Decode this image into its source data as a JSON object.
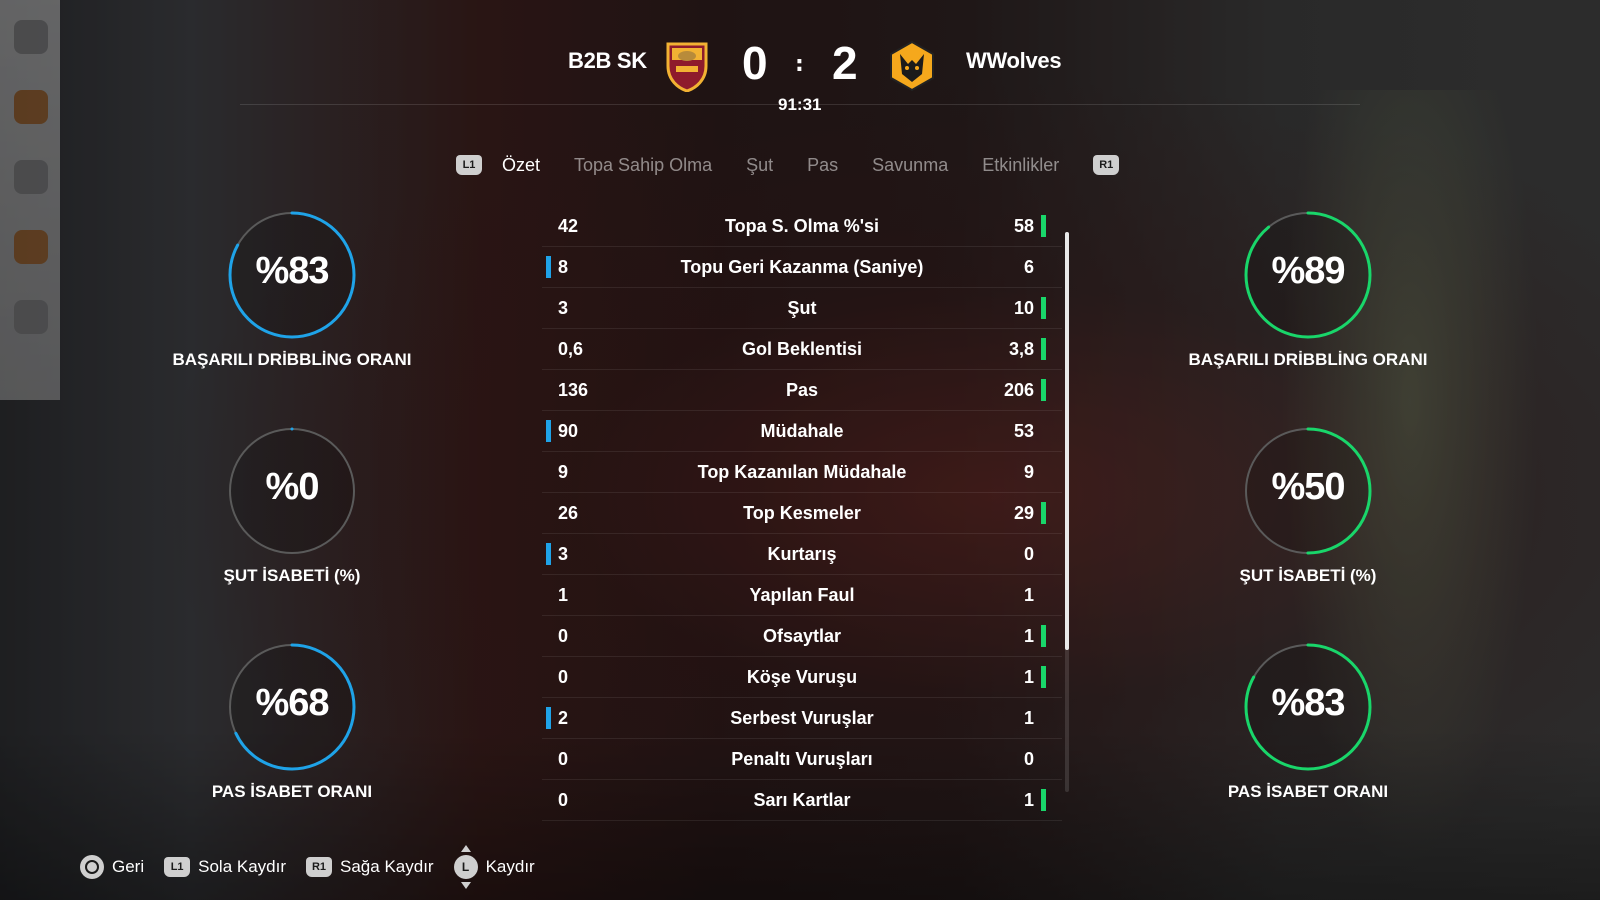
{
  "match": {
    "home_team": "B2B SK",
    "away_team": "WWolves",
    "home_score": "0",
    "away_score": "2",
    "separator": ":",
    "clock": "91:31",
    "home_crest": "roma-crest-icon",
    "away_crest": "wolves-crest-icon"
  },
  "tabs": {
    "left_shoulder": "L1",
    "right_shoulder": "R1",
    "items": [
      {
        "label": "Özet",
        "active": true
      },
      {
        "label": "Topa Sahip Olma",
        "active": false
      },
      {
        "label": "Şut",
        "active": false
      },
      {
        "label": "Pas",
        "active": false
      },
      {
        "label": "Savunma",
        "active": false
      },
      {
        "label": "Etkinlikler",
        "active": false
      }
    ]
  },
  "stats": [
    {
      "label": "Topa S. Olma %'si",
      "home": "42",
      "away": "58",
      "leader": "away"
    },
    {
      "label": "Topu Geri Kazanma (Saniye)",
      "home": "8",
      "away": "6",
      "leader": "home"
    },
    {
      "label": "Şut",
      "home": "3",
      "away": "10",
      "leader": "away"
    },
    {
      "label": "Gol Beklentisi",
      "home": "0,6",
      "away": "3,8",
      "leader": "away"
    },
    {
      "label": "Pas",
      "home": "136",
      "away": "206",
      "leader": "away"
    },
    {
      "label": "Müdahale",
      "home": "90",
      "away": "53",
      "leader": "home"
    },
    {
      "label": "Top Kazanılan Müdahale",
      "home": "9",
      "away": "9",
      "leader": "none"
    },
    {
      "label": "Top Kesmeler",
      "home": "26",
      "away": "29",
      "leader": "away"
    },
    {
      "label": "Kurtarış",
      "home": "3",
      "away": "0",
      "leader": "home"
    },
    {
      "label": "Yapılan Faul",
      "home": "1",
      "away": "1",
      "leader": "none"
    },
    {
      "label": "Ofsaytlar",
      "home": "0",
      "away": "1",
      "leader": "away"
    },
    {
      "label": "Köşe Vuruşu",
      "home": "0",
      "away": "1",
      "leader": "away"
    },
    {
      "label": "Serbest Vuruşlar",
      "home": "2",
      "away": "1",
      "leader": "home"
    },
    {
      "label": "Penaltı Vuruşları",
      "home": "0",
      "away": "0",
      "leader": "none"
    },
    {
      "label": "Sarı Kartlar",
      "home": "0",
      "away": "1",
      "leader": "away"
    }
  ],
  "gauges": {
    "home": [
      {
        "text": "%83",
        "value": 83,
        "label": "BAŞARILI DRİBBLİNG ORANI"
      },
      {
        "text": "%0",
        "value": 0,
        "label": "ŞUT İSABETİ (%)"
      },
      {
        "text": "%68",
        "value": 68,
        "label": "PAS İSABET ORANI"
      }
    ],
    "away": [
      {
        "text": "%89",
        "value": 89,
        "label": "BAŞARILI DRİBBLİNG ORANI"
      },
      {
        "text": "%50",
        "value": 50,
        "label": "ŞUT İSABETİ (%)"
      },
      {
        "text": "%83",
        "value": 83,
        "label": "PAS İSABET ORANI"
      }
    ]
  },
  "colors": {
    "home_accent": "#1fa3e8",
    "away_accent": "#19d66a",
    "track": "#5a5a5a"
  },
  "footer": {
    "back": {
      "icon": "circle-button-icon",
      "label": "Geri"
    },
    "scroll_left": {
      "icon": "L1",
      "label": "Sola Kaydır"
    },
    "scroll_right": {
      "icon": "R1",
      "label": "Sağa Kaydır"
    },
    "scroll": {
      "icon": "L",
      "label": "Kaydır"
    }
  }
}
